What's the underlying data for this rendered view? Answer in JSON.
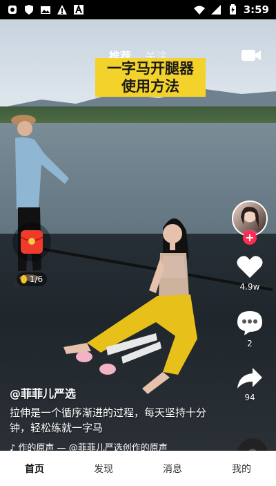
{
  "status_bar": {
    "time": "3:59",
    "left_icons": [
      "notification-icon",
      "shield-icon",
      "image-icon",
      "warning-icon",
      "font-icon"
    ],
    "right_icons": [
      "wifi-icon",
      "signal-icon",
      "battery-icon"
    ]
  },
  "top_tabs": [
    {
      "label": "推荐",
      "active": true
    },
    {
      "label": "关注",
      "active": false
    }
  ],
  "video": {
    "title_line1": "一字马开腿器",
    "title_line2": "使用方法"
  },
  "actions": {
    "like_count": "4.9w",
    "comment_count": "2",
    "share_count": "94"
  },
  "red_packet": {
    "progress": "1/6"
  },
  "caption": {
    "username": "@菲菲儿严选",
    "description": "拉伸是一个循序渐进的过程，每天坚持十分钟，轻松练就一字马",
    "music": "♪ 作的原声 — @菲菲儿严选创作的原声"
  },
  "bottom_nav": [
    {
      "label": "首页",
      "active": true
    },
    {
      "label": "发现",
      "active": false
    },
    {
      "label": "消息",
      "active": false
    },
    {
      "label": "我的",
      "active": false
    }
  ],
  "colors": {
    "accent": "#fe2c55",
    "banner": "#f3d22b"
  }
}
